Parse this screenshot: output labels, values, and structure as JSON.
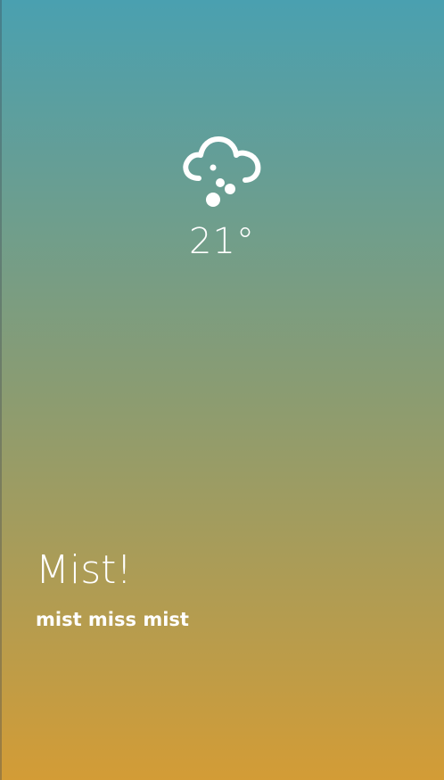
{
  "weather": {
    "icon": "cloud-hail-icon",
    "temperature": "21°",
    "headline": "Mist!",
    "description": "mist miss mist"
  },
  "colors": {
    "gradient_top": "#4aa0b0",
    "gradient_middle": "#8a9c72",
    "gradient_bottom": "#d39c36",
    "text": "#ffffff"
  }
}
